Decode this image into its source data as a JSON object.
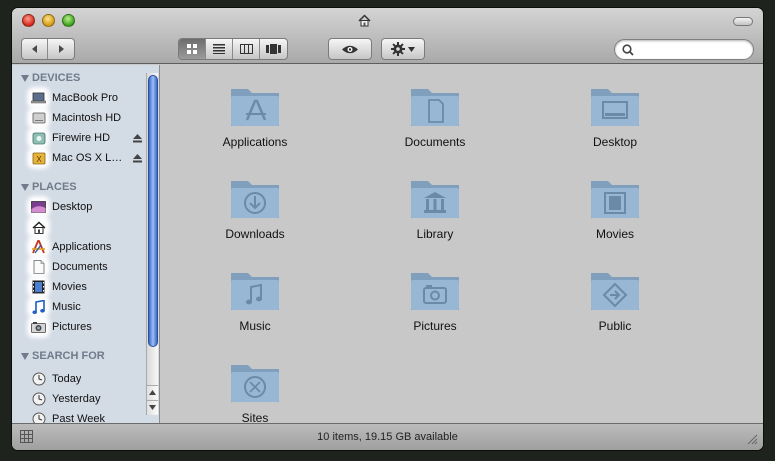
{
  "window": {
    "title": "",
    "title_icon": "home-icon"
  },
  "toolbar": {
    "back_icon": "back-arrow-icon",
    "forward_icon": "forward-arrow-icon",
    "views": [
      {
        "name": "icon-view",
        "icon": "grid-icon",
        "active": true
      },
      {
        "name": "list-view",
        "icon": "list-icon",
        "active": false
      },
      {
        "name": "column-view",
        "icon": "columns-icon",
        "active": false
      },
      {
        "name": "coverflow-view",
        "icon": "coverflow-icon",
        "active": false
      }
    ],
    "quicklook_icon": "eye-icon",
    "action_icon": "gear-icon",
    "search": {
      "value": "",
      "placeholder": ""
    }
  },
  "sidebar": {
    "sections": [
      {
        "title": "DEVICES",
        "items": [
          {
            "label": "MacBook Pro",
            "icon": "laptop-icon"
          },
          {
            "label": "Macintosh HD",
            "icon": "hard-drive-icon"
          },
          {
            "label": "Firewire HD",
            "icon": "external-drive-icon",
            "eject": true
          },
          {
            "label": "Mac OS X L…",
            "icon": "disk-image-icon",
            "eject": true
          }
        ]
      },
      {
        "title": "PLACES",
        "items": [
          {
            "label": "Desktop",
            "icon": "desktop-icon"
          },
          {
            "label": "",
            "icon": "home-icon"
          },
          {
            "label": "Applications",
            "icon": "applications-icon"
          },
          {
            "label": "Documents",
            "icon": "document-icon"
          },
          {
            "label": "Movies",
            "icon": "film-icon"
          },
          {
            "label": "Music",
            "icon": "music-note-icon"
          },
          {
            "label": "Pictures",
            "icon": "camera-icon"
          }
        ]
      },
      {
        "title": "SEARCH FOR",
        "items": [
          {
            "label": "Today",
            "icon": "clock-icon"
          },
          {
            "label": "Yesterday",
            "icon": "clock-icon"
          },
          {
            "label": "Past Week",
            "icon": "clock-icon"
          }
        ]
      }
    ]
  },
  "files": [
    {
      "name": "Applications",
      "glyph": "applications"
    },
    {
      "name": "Documents",
      "glyph": "documents"
    },
    {
      "name": "Desktop",
      "glyph": "desktop"
    },
    {
      "name": "Downloads",
      "glyph": "downloads"
    },
    {
      "name": "Library",
      "glyph": "library"
    },
    {
      "name": "Movies",
      "glyph": "movies"
    },
    {
      "name": "Music",
      "glyph": "music"
    },
    {
      "name": "Pictures",
      "glyph": "pictures"
    },
    {
      "name": "Public",
      "glyph": "public"
    },
    {
      "name": "Sites",
      "glyph": "sites"
    }
  ],
  "status": {
    "text": "10 items, 19.15 GB available"
  }
}
